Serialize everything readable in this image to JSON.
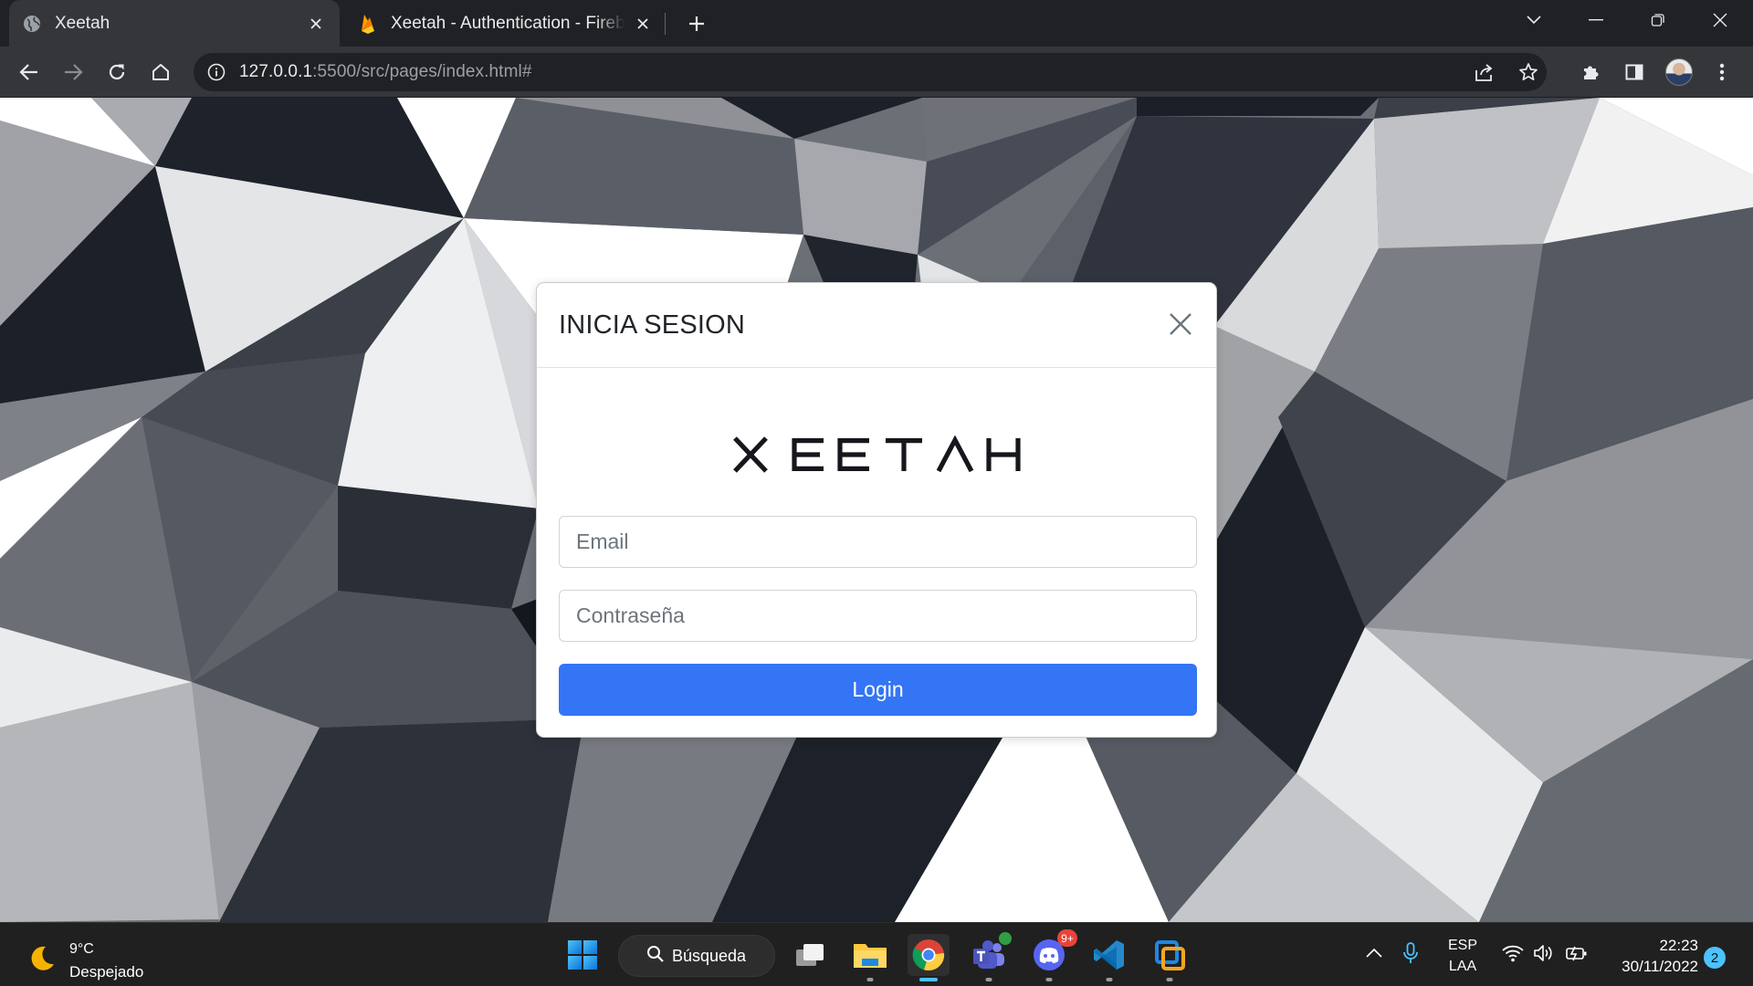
{
  "browser": {
    "tabs": [
      {
        "title": "Xeetah",
        "favicon": "globe-icon",
        "active": true
      },
      {
        "title": "Xeetah - Authentication - Firebase console",
        "favicon": "firebase-icon",
        "active": false
      }
    ],
    "url_host": "127.0.0.1",
    "url_rest": ":5500/src/pages/index.html#"
  },
  "modal": {
    "title": "INICIA SESION",
    "brand": "XEETAH",
    "email_placeholder": "Email",
    "password_placeholder": "Contraseña",
    "login_label": "Login",
    "primary_color": "#3375f5"
  },
  "taskbar": {
    "weather_temp": "9°C",
    "weather_desc": "Despejado",
    "search_label": "Búsqueda",
    "apps": [
      "start-icon",
      "file-explorer-icon",
      "chrome-icon",
      "teams-icon",
      "discord-icon",
      "vscode-icon",
      "virtualbox-icon"
    ],
    "teams_badge": "",
    "discord_badge": "9+",
    "lang_top": "ESP",
    "lang_bottom": "LAA",
    "time": "22:23",
    "date": "30/11/2022",
    "notification_count": "2"
  }
}
